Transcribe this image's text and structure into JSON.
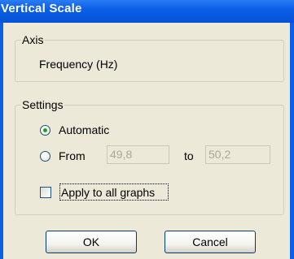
{
  "window": {
    "title": "Vertical Scale"
  },
  "axis_group": {
    "legend": "Axis",
    "value": "Frequency (Hz)"
  },
  "settings_group": {
    "legend": "Settings",
    "automatic_label": "Automatic",
    "automatic_selected": true,
    "from_label": "From",
    "from_selected": false,
    "from_value": "49,8",
    "to_label": "to",
    "to_value": "50,2",
    "apply_all_label": "Apply to all graphs",
    "apply_all_checked": false
  },
  "buttons": {
    "ok_label": "OK",
    "cancel_label": "Cancel"
  },
  "colors": {
    "title_bar": "#0a5fe6",
    "dialog_face": "#ece9d8",
    "radio_selected_dot": "#21a121"
  }
}
